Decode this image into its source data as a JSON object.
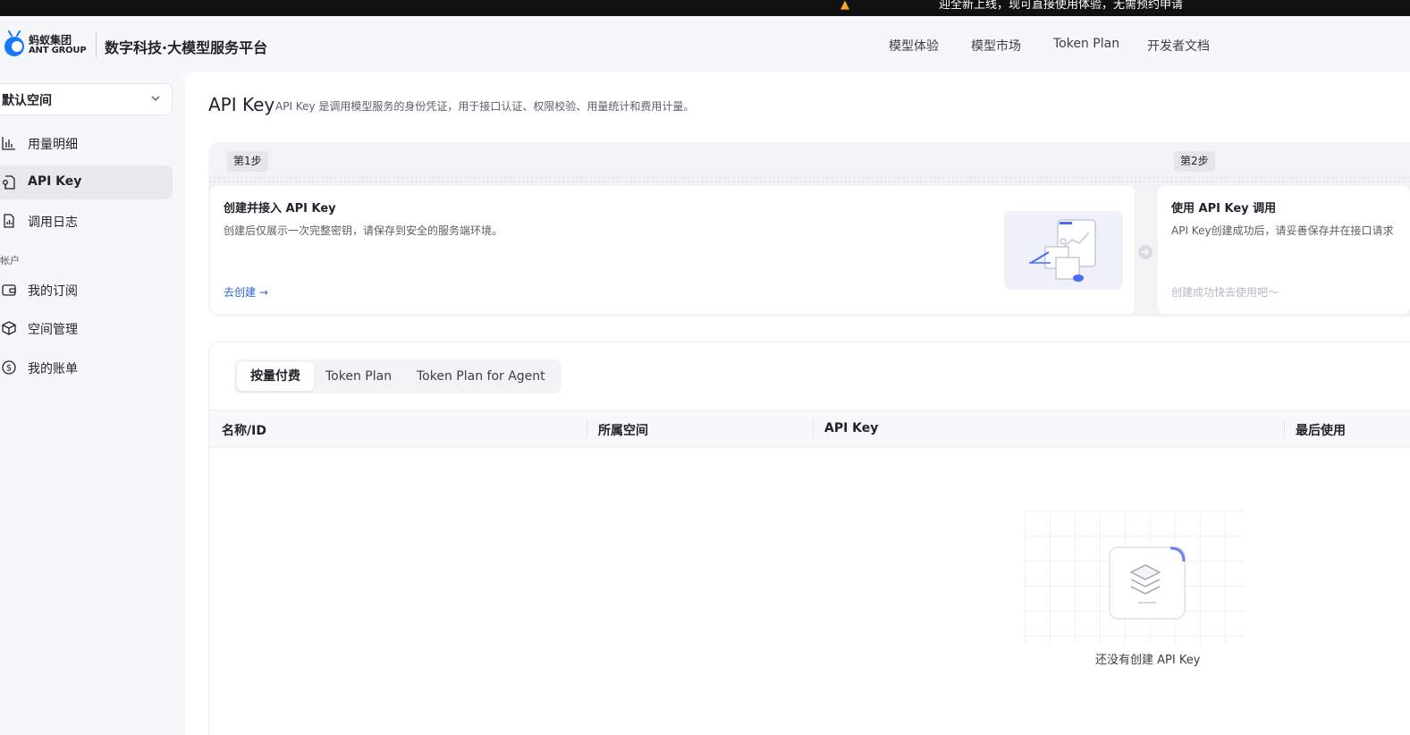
{
  "topbar": {
    "notice": "迎全新上线，现可直接使用体验，无需预约申请"
  },
  "header": {
    "logo_cn": "蚂蚁集团",
    "logo_en": "ANT GROUP",
    "platform_title": "数字科技·大模型服务平台",
    "nav": [
      "模型体验",
      "模型市场",
      "Token Plan",
      "开发者文档"
    ]
  },
  "sidebar": {
    "space_selector": "默认空间",
    "items": [
      {
        "label": "用量明细",
        "icon": "bar-chart-icon"
      },
      {
        "label": "API Key",
        "icon": "key-icon",
        "active": true
      },
      {
        "label": "调用日志",
        "icon": "log-file-icon"
      }
    ],
    "account_section": "帐户",
    "account_items": [
      {
        "label": "我的订阅",
        "icon": "wallet-icon"
      },
      {
        "label": "空间管理",
        "icon": "cube-icon"
      },
      {
        "label": "我的账单",
        "icon": "dollar-circle-icon"
      }
    ]
  },
  "page": {
    "title": "API Key",
    "description": "API Key 是调用模型服务的身份凭证，用于接口认证、权限校验、用量统计和费用计量。"
  },
  "steps": [
    {
      "tag": "第1步",
      "title": "创建并接入 API Key",
      "desc": "创建后仅展示一次完整密钥，请保存到安全的服务端环境。",
      "action": "去创建 →"
    },
    {
      "tag": "第2步",
      "title": "使用 API Key 调用",
      "desc": "API Key创建成功后，请妥善保存并在接口请求",
      "hint": "创建成功快去使用吧～"
    }
  ],
  "tabs": [
    "按量付费",
    "Token Plan",
    "Token Plan for Agent"
  ],
  "table": {
    "columns": [
      "名称/ID",
      "所属空间",
      "API Key",
      "最后使用"
    ],
    "rows": [],
    "empty_text": "还没有创建 API Key"
  },
  "colors": {
    "accent": "#2e63d8",
    "brand_blue": "#1677ff",
    "active_bg": "#e8e9ec"
  }
}
